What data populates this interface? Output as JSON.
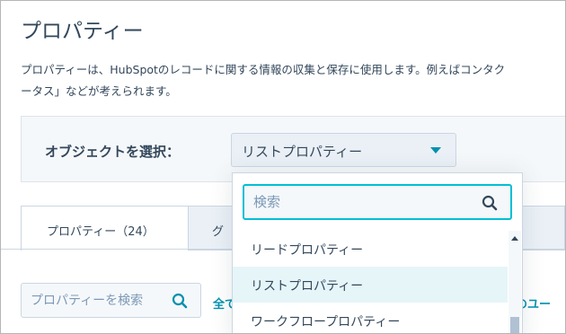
{
  "page": {
    "title": "プロパティー",
    "description_line1": "プロパティーは、HubSpotのレコードに関する情報の収集と保存に使用します。例えばコンタク",
    "description_line2": "ータス」などが考えられます。"
  },
  "object_selector": {
    "label": "オブジェクトを選択：",
    "selected_value": "リストプロパティー"
  },
  "dropdown": {
    "search_placeholder": "検索",
    "options": [
      {
        "label": "リードプロパティー",
        "selected": false
      },
      {
        "label": "リストプロパティー",
        "selected": true
      },
      {
        "label": "ワークフロープロパティー",
        "selected": false
      }
    ]
  },
  "tabs": [
    {
      "label": "プロパティー（24）",
      "active": true
    },
    {
      "label": "グ",
      "active": false
    }
  ],
  "property_search": {
    "placeholder": "プロパティーを検索"
  },
  "filters": {
    "left_link": "全て",
    "right_link": "てのユー"
  },
  "icons": {
    "search": "search-icon",
    "caret": "caret-down-icon",
    "scroll_up": "scroll-up-arrow-icon"
  },
  "colors": {
    "text": "#33475b",
    "accent": "#0091ae",
    "focus_border": "#00bfd6",
    "selected_option_bg": "#e5f5f8",
    "panel_bg": "#f5f8fa"
  }
}
